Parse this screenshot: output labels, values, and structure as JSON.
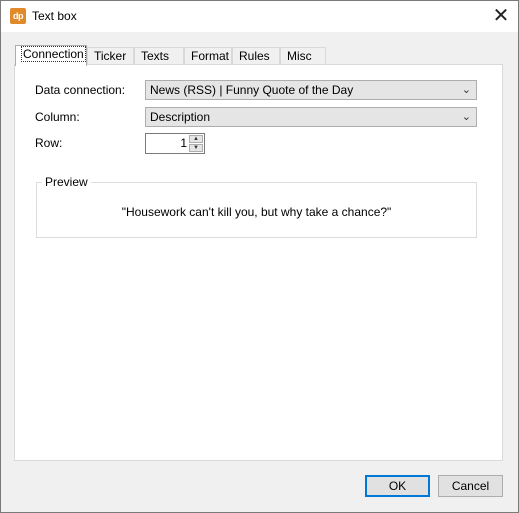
{
  "window": {
    "title": "Text box",
    "icon_text": "dp",
    "close_glyph": "✕"
  },
  "tabs": [
    "Connection",
    "Ticker",
    "Texts",
    "Format",
    "Rules",
    "Misc"
  ],
  "active_tab": "Connection",
  "connection": {
    "data_connection_label": "Data connection:",
    "data_connection_value": "News (RSS) | Funny Quote of the Day",
    "column_label": "Column:",
    "column_value": "Description",
    "row_label": "Row:",
    "row_value": "1"
  },
  "preview": {
    "legend": "Preview",
    "text": "\"Housework can't kill you, but why take a chance?\""
  },
  "buttons": {
    "ok": "OK",
    "cancel": "Cancel"
  },
  "colors": {
    "accent": "#0078d7",
    "icon_bg": "#e08a2c"
  }
}
